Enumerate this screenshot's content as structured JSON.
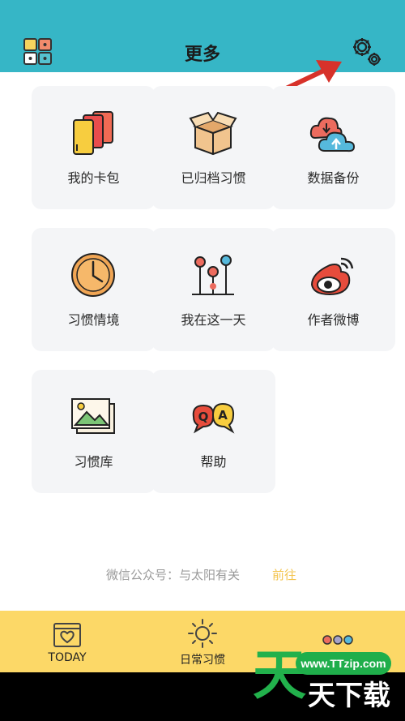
{
  "header": {
    "title": "更多",
    "icons": {
      "menu": "grid-icon",
      "settings": "gear-icon"
    },
    "color": "#36b6c6"
  },
  "cards": [
    {
      "label": "我的卡包",
      "icon": "cards-icon"
    },
    {
      "label": "已归档习惯",
      "icon": "box-icon"
    },
    {
      "label": "数据备份",
      "icon": "cloud-sync-icon"
    },
    {
      "label": "习惯情境",
      "icon": "clock-icon"
    },
    {
      "label": "我在这一天",
      "icon": "timeline-icon"
    },
    {
      "label": "作者微博",
      "icon": "weibo-icon"
    },
    {
      "label": "习惯库",
      "icon": "gallery-icon"
    },
    {
      "label": "帮助",
      "icon": "qa-icon"
    }
  ],
  "footer": {
    "wechat": "微信公众号：与太阳有关",
    "goto": "前往"
  },
  "tabs": [
    {
      "label": "TODAY",
      "icon": "calendar-heart-icon"
    },
    {
      "label": "日常习惯",
      "icon": "sun-icon"
    },
    {
      "label": "",
      "icon": "more-dots-icon"
    }
  ],
  "tabbar_color": "#fcd867",
  "watermark": {
    "site": "www.TTzip.com",
    "big": "天",
    "small": "天下载"
  }
}
